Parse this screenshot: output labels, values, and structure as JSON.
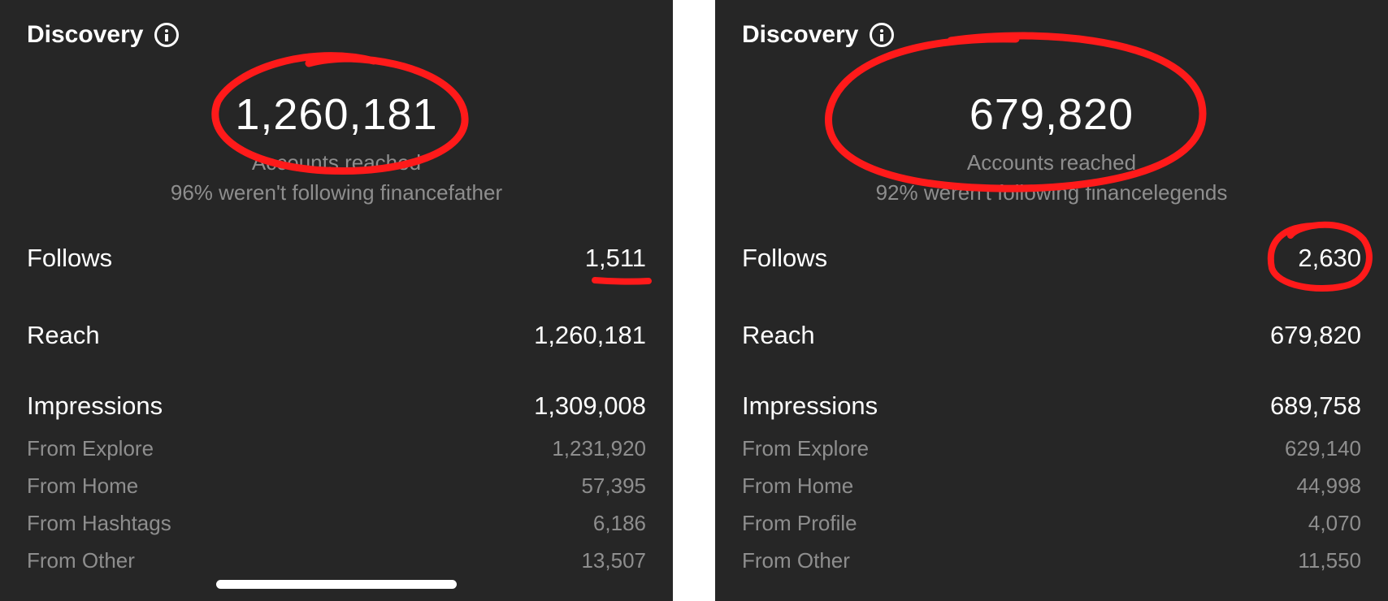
{
  "panels": [
    {
      "section_title": "Discovery",
      "accounts_reached": "1,260,181",
      "accounts_reached_label": "Accounts reached",
      "not_following_text": "96% weren't following financefather",
      "rows": [
        {
          "label": "Follows",
          "value": "1,511"
        },
        {
          "label": "Reach",
          "value": "1,260,181"
        },
        {
          "label": "Impressions",
          "value": "1,309,008"
        }
      ],
      "impression_sources": [
        {
          "label": "From Explore",
          "value": "1,231,920"
        },
        {
          "label": "From Home",
          "value": "57,395"
        },
        {
          "label": "From Hashtags",
          "value": "6,186"
        },
        {
          "label": "From Other",
          "value": "13,507"
        }
      ]
    },
    {
      "section_title": "Discovery",
      "accounts_reached": "679,820",
      "accounts_reached_label": "Accounts reached",
      "not_following_text": "92% weren't following financelegends",
      "rows": [
        {
          "label": "Follows",
          "value": "2,630"
        },
        {
          "label": "Reach",
          "value": "679,820"
        },
        {
          "label": "Impressions",
          "value": "689,758"
        }
      ],
      "impression_sources": [
        {
          "label": "From Explore",
          "value": "629,140"
        },
        {
          "label": "From Home",
          "value": "44,998"
        },
        {
          "label": "From Profile",
          "value": "4,070"
        },
        {
          "label": "From Other",
          "value": "11,550"
        }
      ]
    }
  ],
  "icons": {
    "info": "info-circle-icon"
  },
  "colors": {
    "panel_background": "#262626",
    "divider": "#ffffff",
    "primary_text": "#ffffff",
    "secondary_text": "#8e8e8e",
    "annotation": "#ff1a1a"
  }
}
